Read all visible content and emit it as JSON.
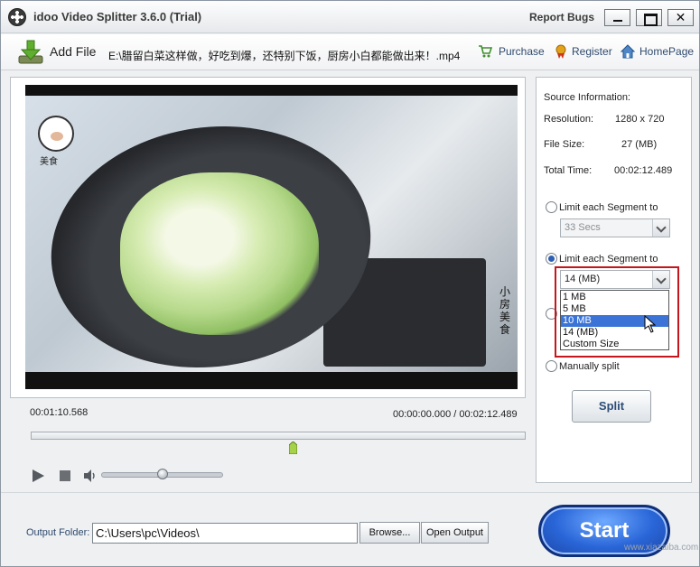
{
  "window": {
    "title": "idoo Video Splitter 3.6.0 (Trial)",
    "report_bugs": "Report Bugs",
    "close_glyph": "✕"
  },
  "toolbar": {
    "add_file": "Add File",
    "file_path": "E:\\腊留白菜这样做，好吃到爆，还特别下饭，厨房小白都能做出来！.mp4",
    "purchase": "Purchase",
    "register": "Register",
    "homepage": "HomePage"
  },
  "video": {
    "watermark_left": "美食",
    "watermark_right": "小房美食"
  },
  "playback": {
    "current_time": "00:01:10.568",
    "range": "00:00:00.000 / 00:02:12.489",
    "volume_level": 0.5,
    "timeline_position": 0.53
  },
  "source_info": {
    "header": "Source Information:",
    "resolution_label": "Resolution:",
    "resolution_value": "1280 x 720",
    "filesize_label": "File Size:",
    "filesize_value": "27 (MB)",
    "totaltime_label": "Total Time:",
    "totaltime_value": "00:02:12.489"
  },
  "split_options": {
    "option1_label": "Limit each Segment to",
    "option1_value": "33 Secs",
    "option2_label": "Limit each Segment to",
    "option2_value": "14 (MB)",
    "size_options": [
      "1 MB",
      "5 MB",
      "10 MB",
      "14 (MB)",
      "Custom Size"
    ],
    "highlighted_index": 2,
    "option4_label": "Manually split",
    "split_button": "Split"
  },
  "output": {
    "label": "Output Folder:",
    "path": "C:\\Users\\pc\\Videos\\",
    "browse": "Browse...",
    "open_output": "Open Output"
  },
  "start_button": "Start",
  "brand_watermark": "www.xiazaiba.com",
  "colors": {
    "accent": "#2a66d8",
    "highlight": "#3b74d6",
    "annotation": "#c4161c"
  }
}
